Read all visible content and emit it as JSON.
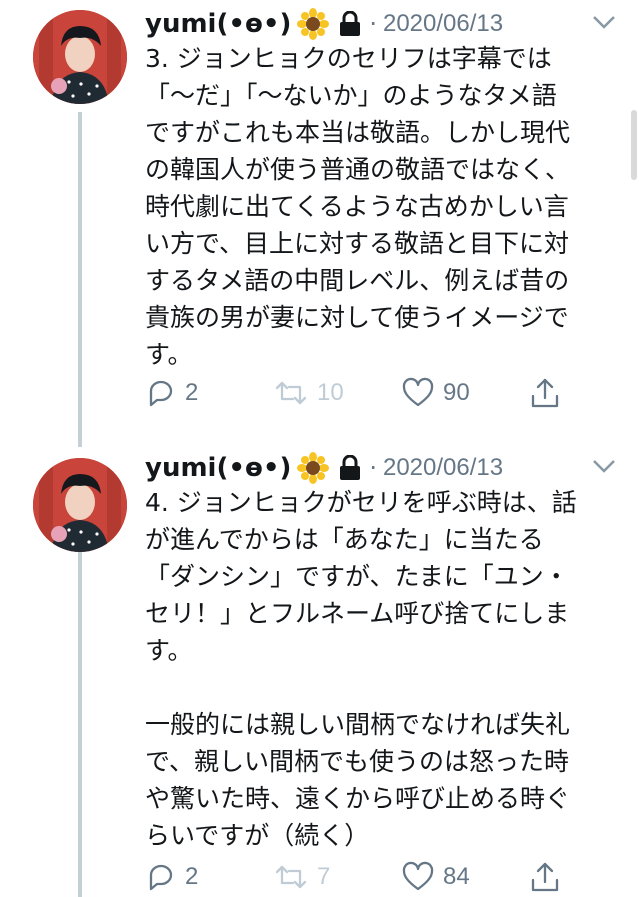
{
  "tweets": [
    {
      "author": "yumi(•ө•)",
      "dot": "·",
      "date": "2020/06/13",
      "lines": [
        "3. ジョンヒョクのセリフは字幕では",
        "「〜だ」「〜ないか」のようなタメ語",
        "ですがこれも本当は敬語。しかし現代",
        "の韓国人が使う普通の敬語ではなく、",
        "時代劇に出てくるような古めかしい言",
        "い方で、目上に対する敬語と目下に対",
        "するタメ語の中間レベル、例えば昔の",
        "貴族の男が妻に対して使うイメージで",
        "す。"
      ],
      "replies": "2",
      "retweets": "10",
      "likes": "90"
    },
    {
      "author": "yumi(•ө•)",
      "dot": "·",
      "date": "2020/06/13",
      "lines": [
        "4. ジョンヒョクがセリを呼ぶ時は、話",
        "が進んでからは「あなた」に当たる",
        "「ダンシン」ですが、たまに「ユン・",
        "セリ！」とフルネーム呼び捨てにしま",
        "す。",
        "",
        "一般的には親しい間柄でなければ失礼",
        "で、親しい間柄でも使うのは怒った時",
        "や驚いた時、遠くから呼び止める時ぐ",
        "らいですが（続く）"
      ],
      "replies": "2",
      "retweets": "7",
      "likes": "84"
    }
  ],
  "icons": {
    "emoji": "sunflower-icon",
    "lock": "lock-icon",
    "menu": "chevron-down-icon",
    "reply": "reply-icon",
    "retweet": "retweet-icon",
    "like": "heart-icon",
    "share": "share-icon"
  },
  "colors": {
    "text": "#14171a",
    "meta": "#657786",
    "thread_line": "#c4cfd6",
    "avatar_bg": "#c9443a"
  }
}
